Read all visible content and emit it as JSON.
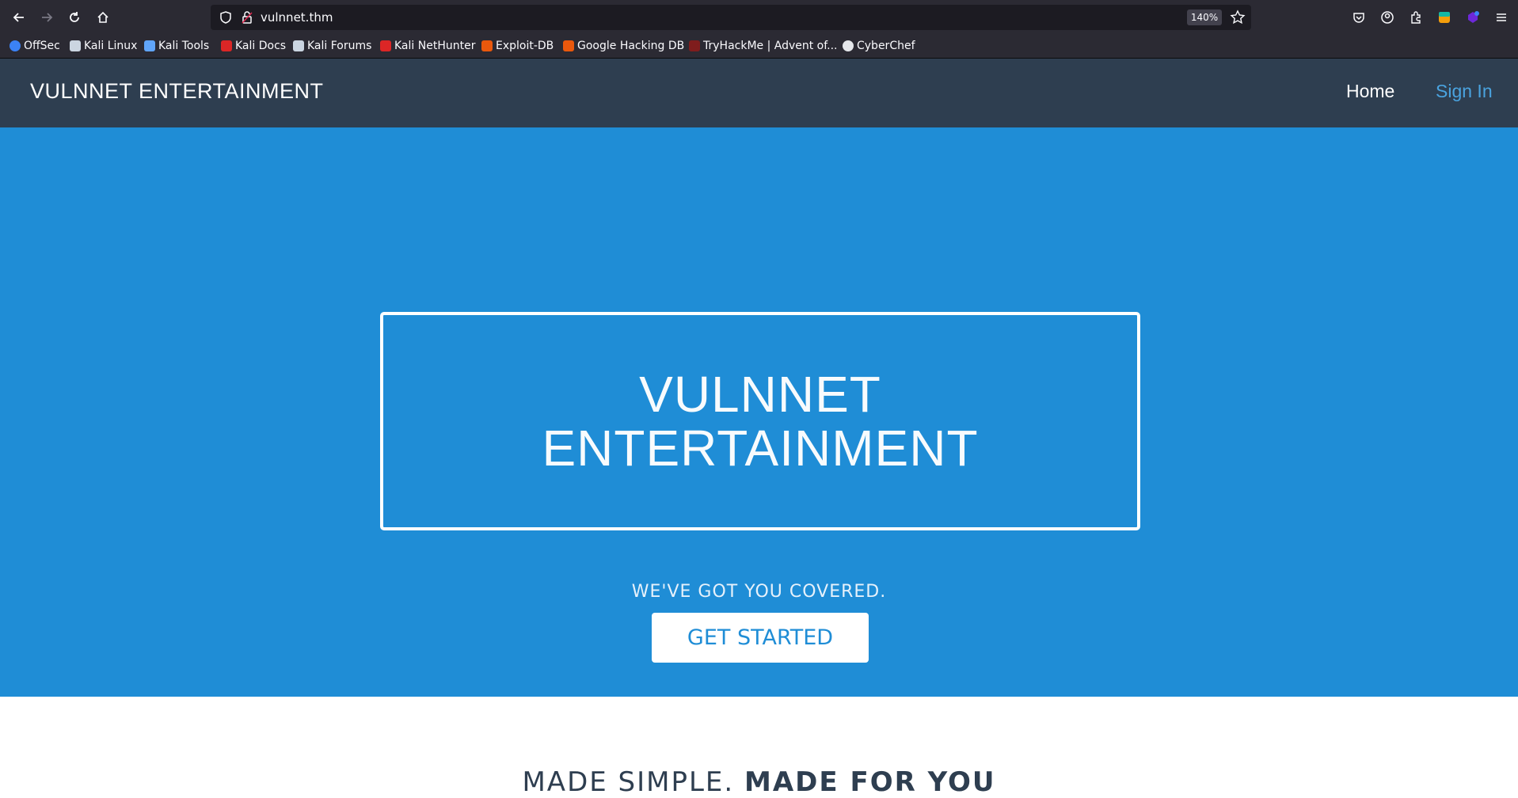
{
  "browser": {
    "url": "vulnnet.thm",
    "zoom": "140%",
    "bookmarks": [
      {
        "label": "OffSec",
        "color": "#3b82f6"
      },
      {
        "label": "Kali Linux",
        "color": "#cbd5e1"
      },
      {
        "label": "Kali Tools",
        "color": "#60a5fa"
      },
      {
        "label": "Kali Docs",
        "color": "#dc2626"
      },
      {
        "label": "Kali Forums",
        "color": "#cbd5e1"
      },
      {
        "label": "Kali NetHunter",
        "color": "#dc2626"
      },
      {
        "label": "Exploit-DB",
        "color": "#ea580c"
      },
      {
        "label": "Google Hacking DB",
        "color": "#ea580c"
      },
      {
        "label": "TryHackMe | Advent of...",
        "color": "#7f1d1d"
      },
      {
        "label": "CyberChef",
        "color": "#e5e7eb"
      }
    ]
  },
  "navbar": {
    "brand": "VULNNET ENTERTAINMENT",
    "home": "Home",
    "signin": "Sign In"
  },
  "hero": {
    "title_line1": "VULNNET",
    "title_line2": "ENTERTAINMENT",
    "tagline": "WE'VE GOT YOU COVERED.",
    "cta": "GET STARTED"
  },
  "section": {
    "heading_light": "MADE SIMPLE. ",
    "heading_bold": "MADE FOR YOU"
  },
  "colors": {
    "navbar_bg": "#2e3e50",
    "hero_bg": "#1f8dd6",
    "signin_link": "#4aa3df"
  }
}
